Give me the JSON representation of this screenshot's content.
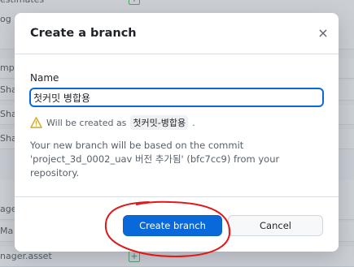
{
  "background": {
    "rows": [
      "estimates",
      "og",
      "",
      "mp",
      "Shad",
      "Shad",
      "Shac",
      "",
      "ager.",
      "Ma",
      "nager.asset"
    ]
  },
  "dialog": {
    "title": "Create a branch",
    "close_label": "×",
    "name_label": "Name",
    "name_value": "첫커밋 병합용",
    "warning_prefix": "Will be created as",
    "warning_code": "첫커밋-병합용",
    "warning_suffix": ".",
    "description": "Your new branch will be based on the commit 'project_3d_0002_uav 버전 추가됨' (bfc7cc9) from your repository.",
    "primary_button": "Create branch",
    "secondary_button": "Cancel"
  },
  "colors": {
    "accent": "#0969da",
    "annotation": "#e0191b",
    "warning": "#d4a72c"
  }
}
